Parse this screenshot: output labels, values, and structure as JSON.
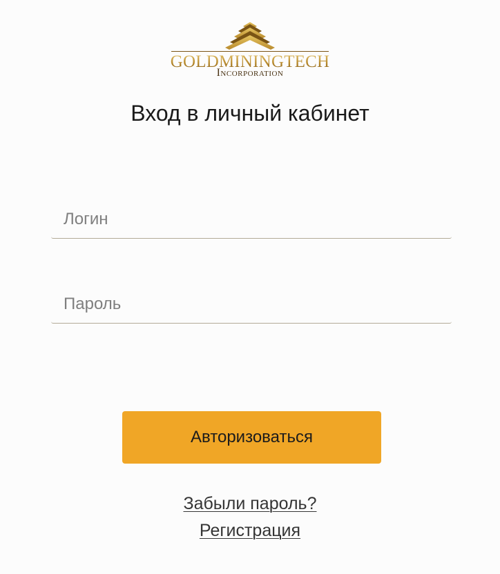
{
  "brand": {
    "wordmark": "GOLDMININGTECH",
    "subtitle": "Incorporation",
    "icon": "golden-pyramid-logo-icon",
    "colors": {
      "gold": "#c79a3a",
      "dark_gold": "#7a5414",
      "brown": "#4a3314"
    }
  },
  "page": {
    "title": "Вход в личный кабинет"
  },
  "form": {
    "login": {
      "placeholder": "Логин",
      "value": ""
    },
    "password": {
      "placeholder": "Пароль",
      "value": ""
    },
    "submit_label": "Авторизоваться"
  },
  "links": {
    "forgot_password": "Забыли пароль?",
    "register": "Регистрация"
  },
  "colors": {
    "accent": "#f0a626",
    "background": "#fcfcfc",
    "field_border": "#b2aa96",
    "link_text": "#353535"
  }
}
